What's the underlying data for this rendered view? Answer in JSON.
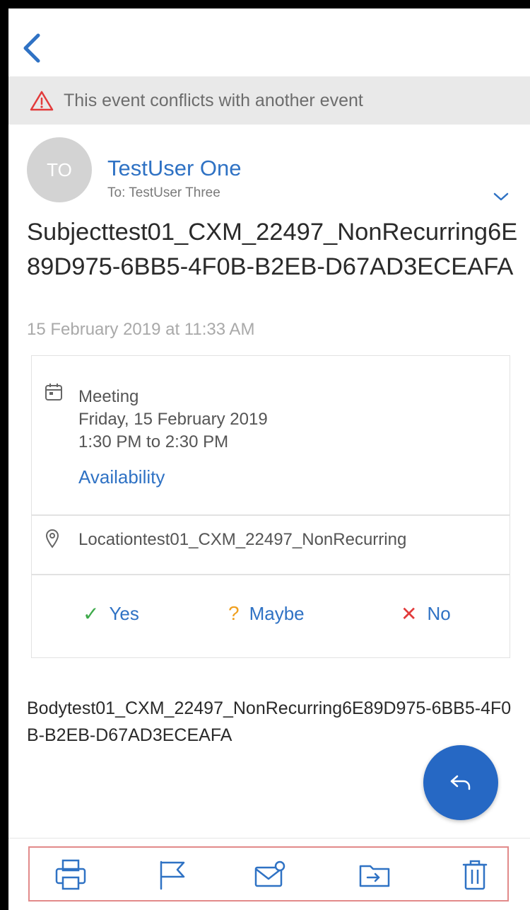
{
  "banner": {
    "text": "This event conflicts with another event"
  },
  "sender": {
    "initials": "TO",
    "name": "TestUser One",
    "to": "To: TestUser Three"
  },
  "message": {
    "subject": "Subjecttest01_CXM_22497_NonRecurring6E89D975-6BB5-4F0B-B2EB-D67AD3ECEAFA",
    "datetime": "15 February 2019 at 11:33 AM",
    "body": "Bodytest01_CXM_22497_NonRecurring6E89D975-6BB5-4F0B-B2EB-D67AD3ECEAFA"
  },
  "event": {
    "label": "Meeting",
    "date": "Friday, 15 February 2019",
    "time": "1:30 PM to 2:30 PM",
    "availability_label": "Availability",
    "location": "Locationtest01_CXM_22497_NonRecurring"
  },
  "rsvp": {
    "yes": {
      "glyph": "✓",
      "label": "Yes"
    },
    "maybe": {
      "glyph": "?",
      "label": "Maybe"
    },
    "no": {
      "glyph": "✕",
      "label": "No"
    }
  },
  "colors": {
    "accent": "#2f72c4",
    "fab": "#2668c4",
    "warning": "#e23b3b",
    "yes": "#3eaa4a",
    "maybe": "#f0a020",
    "no": "#e23b3b",
    "toolbar_highlight": "#e28a8a"
  },
  "icons": {
    "back": "chevron-left-icon",
    "warning": "warning-triangle-icon",
    "calendar": "calendar-icon",
    "location": "location-pin-icon",
    "reply": "reply-icon",
    "toolbar": [
      "print-icon",
      "flag-icon",
      "mark-unread-icon",
      "move-icon",
      "delete-icon"
    ]
  }
}
